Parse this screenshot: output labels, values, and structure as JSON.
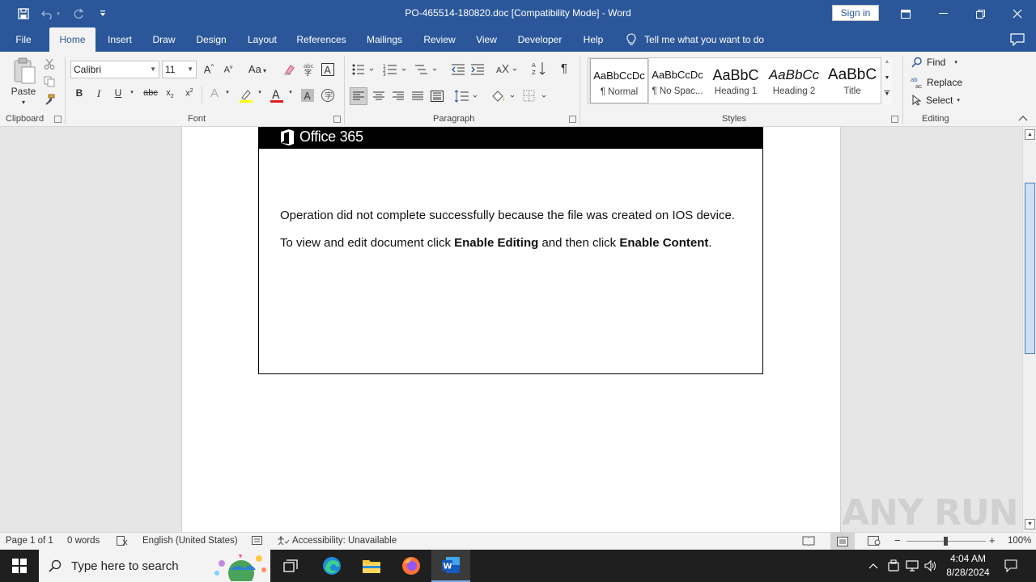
{
  "window": {
    "title": "PO-465514-180820.doc [Compatibility Mode]  -  Word",
    "sign_in": "Sign in"
  },
  "tabs": [
    {
      "label": "File"
    },
    {
      "label": "Home"
    },
    {
      "label": "Insert"
    },
    {
      "label": "Draw"
    },
    {
      "label": "Design"
    },
    {
      "label": "Layout"
    },
    {
      "label": "References"
    },
    {
      "label": "Mailings"
    },
    {
      "label": "Review"
    },
    {
      "label": "View"
    },
    {
      "label": "Developer"
    },
    {
      "label": "Help"
    }
  ],
  "tell_me": "Tell me what you want to do",
  "ribbon": {
    "clipboard": {
      "paste": "Paste",
      "label": "Clipboard"
    },
    "font": {
      "name": "Calibri",
      "size": "11",
      "label": "Font"
    },
    "paragraph": {
      "label": "Paragraph"
    },
    "styles": {
      "label": "Styles",
      "items": [
        {
          "preview": "AaBbCcDc",
          "name": "¶ Normal"
        },
        {
          "preview": "AaBbCcDc",
          "name": "¶ No Spac..."
        },
        {
          "preview": "AaBbC",
          "name": "Heading 1"
        },
        {
          "preview": "AaBbCc",
          "name": "Heading 2"
        },
        {
          "preview": "AaBbC",
          "name": "Title"
        }
      ]
    },
    "editing": {
      "find": "Find",
      "replace": "Replace",
      "select": "Select",
      "label": "Editing"
    }
  },
  "document": {
    "banner_brand": "Office 365",
    "line1": "Operation did not complete successfully because the file was created on IOS device.",
    "line2_prefix": "To view and edit document click ",
    "line2_bold1": "Enable Editing",
    "line2_middle": " and then click ",
    "line2_bold2": "Enable Content",
    "line2_suffix": "."
  },
  "status": {
    "page": "Page 1 of 1",
    "words": "0 words",
    "language": "English (United States)",
    "accessibility": "Accessibility: Unavailable",
    "zoom": "100%"
  },
  "watermark": "ANY RUN",
  "taskbar": {
    "search_placeholder": "Type here to search",
    "time": "4:04 AM",
    "date": "8/28/2024"
  },
  "colors": {
    "word_blue": "#2b579a",
    "banner_black": "#000000",
    "taskbar": "#1f1f1f"
  }
}
